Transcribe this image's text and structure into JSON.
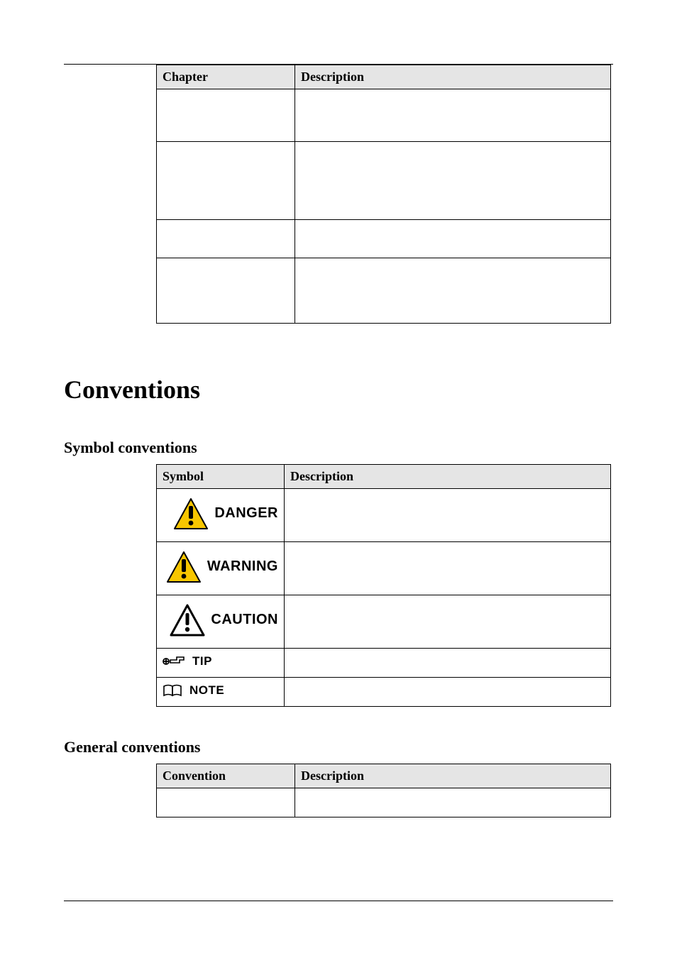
{
  "tables": {
    "chapter": {
      "headers": {
        "col1": "Chapter",
        "col2": "Description"
      },
      "rows": [
        {
          "chapter": "",
          "description": ""
        },
        {
          "chapter": "",
          "description": ""
        },
        {
          "chapter": "",
          "description": ""
        },
        {
          "chapter": "",
          "description": ""
        }
      ]
    },
    "symbols": {
      "headers": {
        "col1": "Symbol",
        "col2": "Description"
      },
      "rows": [
        {
          "icon": "triangle-alert-filled-icon",
          "label": "DANGER",
          "description": ""
        },
        {
          "icon": "triangle-alert-filled-icon",
          "label": "WARNING",
          "description": ""
        },
        {
          "icon": "triangle-alert-outline-icon",
          "label": "CAUTION",
          "description": ""
        },
        {
          "icon": "tip-hand-icon",
          "label": "TIP",
          "description": ""
        },
        {
          "icon": "note-book-icon",
          "label": "NOTE",
          "description": ""
        }
      ]
    },
    "general": {
      "headers": {
        "col1": "Convention",
        "col2": "Description"
      },
      "rows": [
        {
          "convention": "",
          "description": ""
        }
      ]
    }
  },
  "headings": {
    "conventions": "Conventions",
    "symbol_conventions": "Symbol conventions",
    "general_conventions": "General conventions"
  },
  "icons": {
    "triangle_fill": "#f7c600",
    "triangle_stroke": "#000000"
  }
}
